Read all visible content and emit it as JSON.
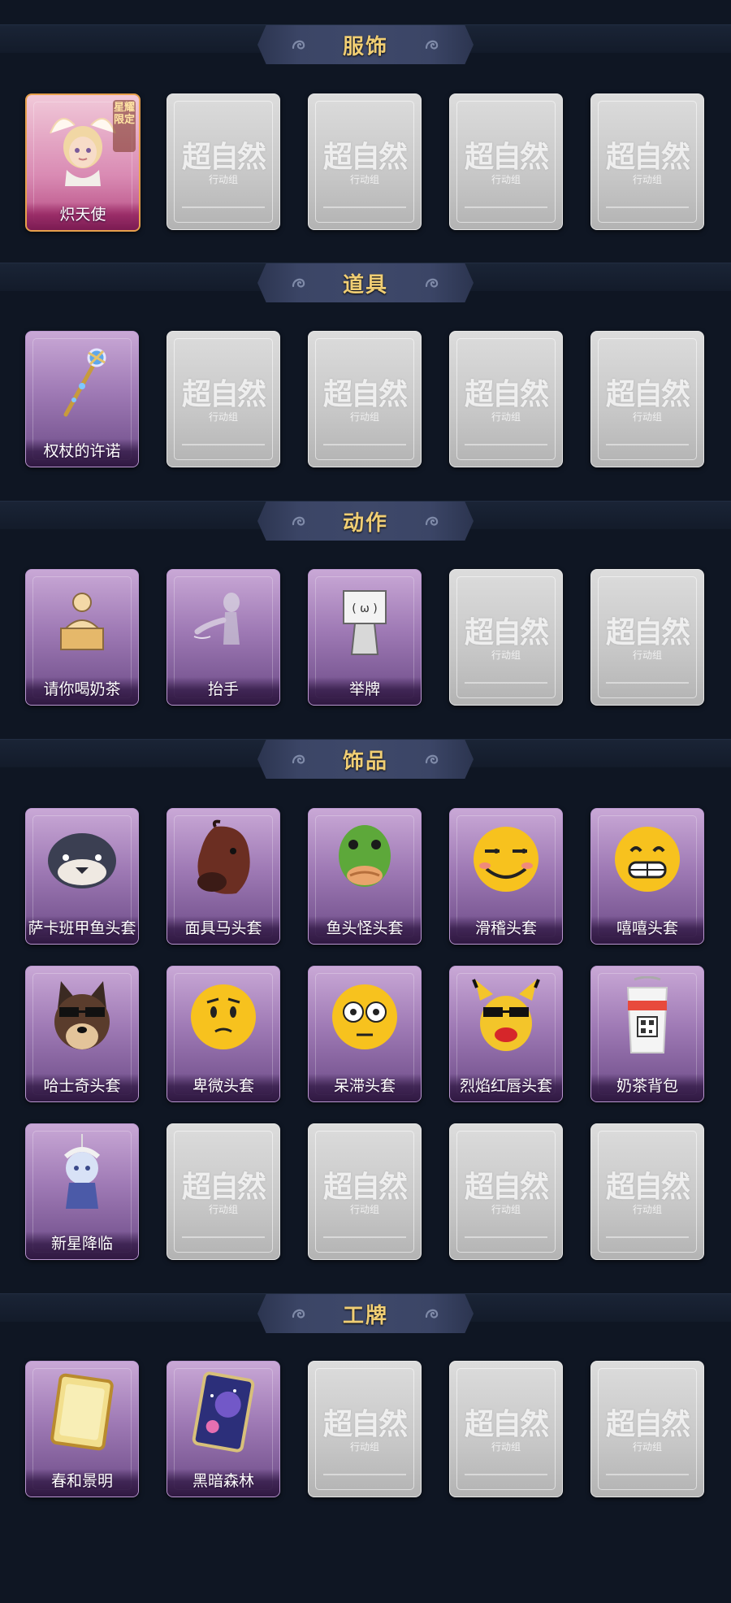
{
  "watermark": {
    "main": "超自然",
    "sub": "行动组"
  },
  "badge": "星耀限定",
  "sections": [
    {
      "title": "服饰",
      "items": [
        {
          "label": "炽天使",
          "icon": "seraph-costume-icon",
          "kind": "costume"
        },
        {
          "empty": true
        },
        {
          "empty": true
        },
        {
          "empty": true
        },
        {
          "empty": true
        }
      ]
    },
    {
      "title": "道具",
      "items": [
        {
          "label": "权杖的许诺",
          "icon": "scepter-icon"
        },
        {
          "empty": true
        },
        {
          "empty": true
        },
        {
          "empty": true
        },
        {
          "empty": true
        }
      ]
    },
    {
      "title": "动作",
      "items": [
        {
          "label": "请你喝奶茶",
          "icon": "milk-tea-gesture-icon"
        },
        {
          "label": "抬手",
          "icon": "raise-hand-icon"
        },
        {
          "label": "举牌",
          "icon": "hold-sign-icon"
        },
        {
          "empty": true
        },
        {
          "empty": true
        }
      ]
    },
    {
      "title": "饰品",
      "items": [
        {
          "label": "萨卡班甲鱼头套",
          "icon": "fish-head-icon"
        },
        {
          "label": "面具马头套",
          "icon": "horse-mask-icon"
        },
        {
          "label": "鱼头怪头套",
          "icon": "green-fish-mask-icon"
        },
        {
          "label": "滑稽头套",
          "icon": "funny-face-icon"
        },
        {
          "label": "嘻嘻头套",
          "icon": "grin-face-icon"
        },
        {
          "label": "哈士奇头套",
          "icon": "husky-mask-icon"
        },
        {
          "label": "卑微头套",
          "icon": "humble-face-icon"
        },
        {
          "label": "呆滞头套",
          "icon": "dazed-face-icon"
        },
        {
          "label": "烈焰红唇头套",
          "icon": "red-lips-mask-icon"
        },
        {
          "label": "奶茶背包",
          "icon": "milk-tea-backpack-icon"
        },
        {
          "label": "新星降临",
          "icon": "star-charm-icon"
        },
        {
          "empty": true
        },
        {
          "empty": true
        },
        {
          "empty": true
        },
        {
          "empty": true
        }
      ]
    },
    {
      "title": "工牌",
      "items": [
        {
          "label": "春和景明",
          "icon": "gold-badge-card-icon"
        },
        {
          "label": "黑暗森林",
          "icon": "galaxy-badge-card-icon"
        },
        {
          "empty": true
        },
        {
          "empty": true
        },
        {
          "empty": true
        }
      ]
    }
  ]
}
